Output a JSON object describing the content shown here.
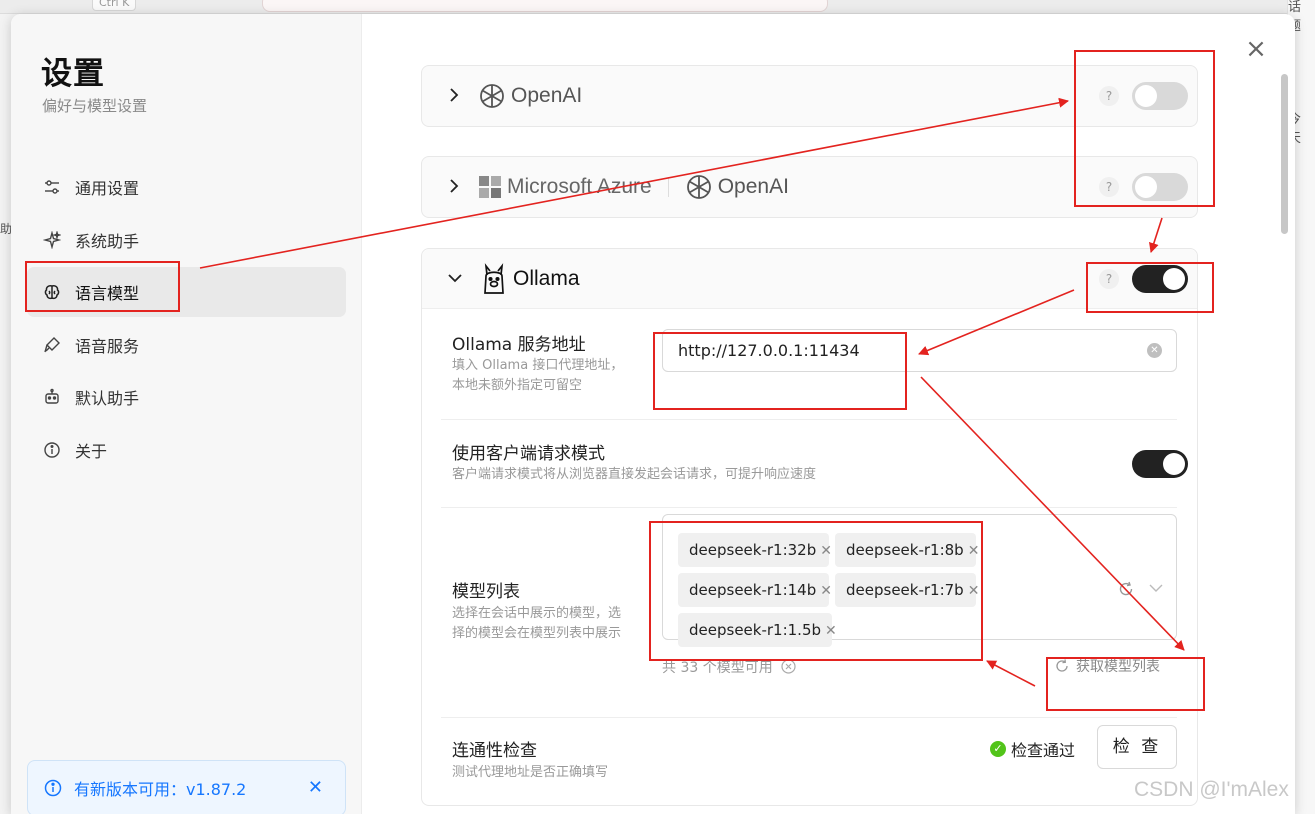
{
  "background": {
    "shortcut_label": "Ctrl K",
    "right_texts": [
      "话题",
      "今天"
    ],
    "left_char": "助"
  },
  "sidebar": {
    "title": "设置",
    "subtitle": "偏好与模型设置",
    "items": [
      {
        "label": "通用设置",
        "icon": "sliders-icon"
      },
      {
        "label": "系统助手",
        "icon": "sparkles-icon"
      },
      {
        "label": "语言模型",
        "icon": "brain-icon",
        "active": true
      },
      {
        "label": "语音服务",
        "icon": "mic-icon"
      },
      {
        "label": "默认助手",
        "icon": "bot-icon"
      },
      {
        "label": "关于",
        "icon": "info-icon"
      }
    ],
    "update_banner": "有新版本可用：v1.87.2"
  },
  "providers": {
    "openai": {
      "name": "OpenAI",
      "enabled": false
    },
    "azure": {
      "name_ms": "Microsoft Azure",
      "name_openai": "OpenAI",
      "enabled": false
    },
    "ollama": {
      "name": "Ollama",
      "enabled": true
    }
  },
  "ollama_settings": {
    "endpoint": {
      "title": "Ollama 服务地址",
      "desc_line1": "填入 Ollama 接口代理地址，",
      "desc_line2": "本地未额外指定可留空",
      "value": "http://127.0.0.1:11434"
    },
    "client_mode": {
      "title": "使用客户端请求模式",
      "desc": "客户端请求模式将从浏览器直接发起会话请求，可提升响应速度",
      "enabled": true
    },
    "model_list": {
      "title": "模型列表",
      "desc_line1": "选择在会话中展示的模型，选",
      "desc_line2": "择的模型会在模型列表中展示",
      "tags": [
        "deepseek-r1:32b",
        "deepseek-r1:8b",
        "deepseek-r1:14b",
        "deepseek-r1:7b",
        "deepseek-r1:1.5b"
      ],
      "count_text": "共 33 个模型可用",
      "fetch_label": "获取模型列表"
    },
    "connectivity": {
      "title": "连通性检查",
      "desc": "测试代理地址是否正确填写",
      "status": "检查通过",
      "button": "检 查"
    }
  },
  "watermark": "CSDN @I'mAlex",
  "colors": {
    "annotation_red": "#e3231f",
    "toggle_on": "#222222",
    "toggle_off": "#d9d9d9",
    "banner_blue": "#1677ff",
    "pass_green": "#52c41a"
  }
}
